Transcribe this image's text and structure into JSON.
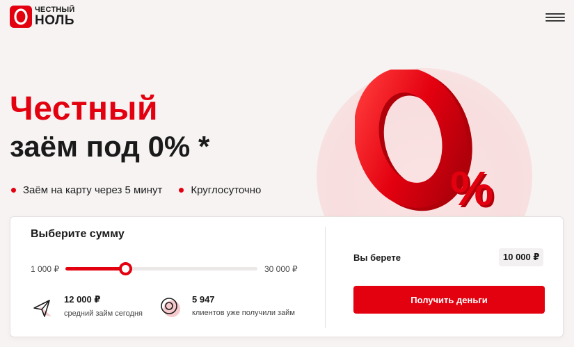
{
  "header": {
    "logo_line1": "ЧЕСТНЫЙ",
    "logo_line2": "НОЛЬ",
    "menu_icon": "hamburger-menu-icon"
  },
  "hero": {
    "title_line1": "Честный",
    "title_line2": "заём под 0% *",
    "features": [
      "Заём на карту через 5 минут",
      "Круглосуточно"
    ],
    "graphic_zero": "0",
    "graphic_percent": "%"
  },
  "calculator": {
    "title": "Выберите сумму",
    "min_label": "1 000 ₽",
    "max_label": "30 000 ₽",
    "slider_min": 1000,
    "slider_max": 30000,
    "slider_value": 10000,
    "stats": [
      {
        "icon": "paper-plane-icon",
        "value": "12 000 ₽",
        "label": "средний займ сегодня"
      },
      {
        "icon": "coin-icon",
        "value": "5 947",
        "label": "клиентов уже получили займ"
      }
    ],
    "take_label": "Вы берете",
    "take_value": "10 000 ₽",
    "cta_label": "Получить деньги"
  },
  "colors": {
    "accent": "#e3000f",
    "background": "#f7f3f3"
  }
}
